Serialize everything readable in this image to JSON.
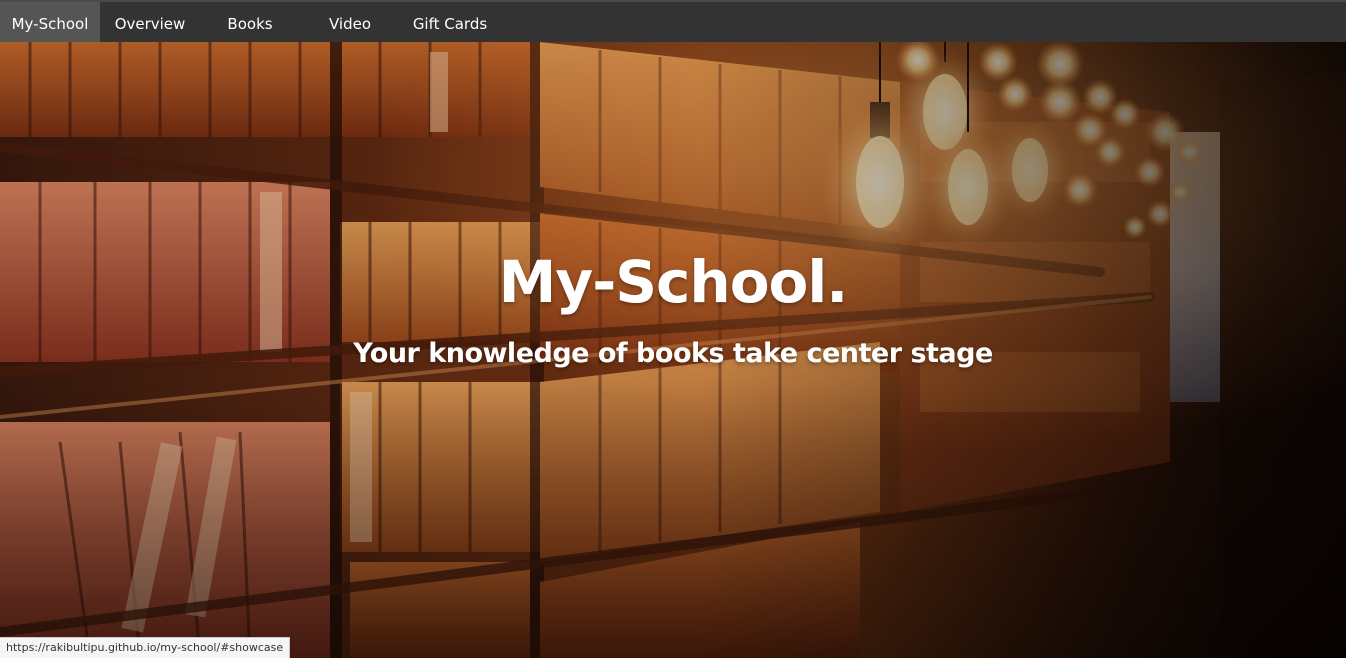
{
  "nav": {
    "items": [
      {
        "label": "My-School",
        "active": true
      },
      {
        "label": "Overview",
        "active": false
      },
      {
        "label": "Books",
        "active": false
      },
      {
        "label": "Video",
        "active": false
      },
      {
        "label": "Gift Cards",
        "active": false
      }
    ]
  },
  "showcase": {
    "title": "My-School.",
    "subtitle": "Your knowledge of books take center stage",
    "background_image": "library-bookshelves-with-hanging-bulbs"
  },
  "status_bar": {
    "url": "https://rakibultipu.github.io/my-school/#showcase"
  },
  "colors": {
    "navbar_bg": "#333333",
    "nav_active_bg": "#555555",
    "nav_text": "#ffffff",
    "hero_text": "#ffffff"
  }
}
